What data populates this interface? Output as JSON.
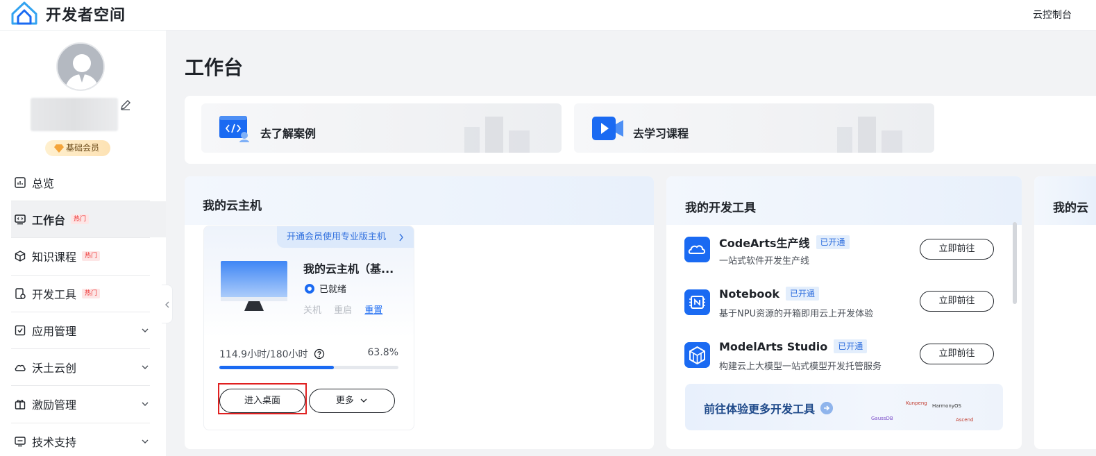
{
  "app": {
    "title": "开发者空间",
    "console_link": "云控制台"
  },
  "user": {
    "member_level": "基础会员"
  },
  "sidebar": {
    "items": [
      {
        "label": "总览",
        "icon": "overview-icon",
        "hot": false,
        "expandable": false,
        "active": false
      },
      {
        "label": "工作台",
        "icon": "workbench-icon",
        "hot": true,
        "expandable": false,
        "active": true
      },
      {
        "label": "知识课程",
        "icon": "cube-icon",
        "hot": true,
        "expandable": false,
        "active": false
      },
      {
        "label": "开发工具",
        "icon": "dev-tools-icon",
        "hot": true,
        "expandable": false,
        "active": false
      },
      {
        "label": "应用管理",
        "icon": "app-manage-icon",
        "hot": false,
        "expandable": true,
        "active": false
      },
      {
        "label": "沃土云创",
        "icon": "cloud-create-icon",
        "hot": false,
        "expandable": true,
        "active": false
      },
      {
        "label": "激励管理",
        "icon": "gift-icon",
        "hot": false,
        "expandable": true,
        "active": false
      },
      {
        "label": "技术支持",
        "icon": "support-icon",
        "hot": false,
        "expandable": true,
        "active": false
      }
    ],
    "hot_label": "热门"
  },
  "main": {
    "title": "工作台",
    "quick_links": [
      {
        "label": "去了解案例",
        "icon": "code-case-icon"
      },
      {
        "label": "去学习课程",
        "icon": "video-course-icon"
      }
    ],
    "cloud_host": {
      "section_title": "我的云主机",
      "vip_banner": "开通会员使用专业版主机",
      "name": "我的云主机（基...",
      "status": "已就绪",
      "actions": {
        "shutdown": "关机",
        "restart": "重启",
        "reset": "重置"
      },
      "usage_text": "114.9小时/180小时",
      "usage_percent_text": "63.8%",
      "usage_fraction": 0.638,
      "enter_button": "进入桌面",
      "more_button": "更多"
    },
    "dev_tools": {
      "section_title": "我的开发工具",
      "tools": [
        {
          "name": "CodeArts生产线",
          "tag": "已开通",
          "desc": "一站式软件开发生产线",
          "button": "立即前往",
          "icon": "codearts-icon"
        },
        {
          "name": "Notebook",
          "tag": "已开通",
          "desc": "基于NPU资源的开箱即用云上开发体验",
          "button": "立即前往",
          "icon": "notebook-icon"
        },
        {
          "name": "ModelArts Studio",
          "tag": "已开通",
          "desc": "构建云上大模型一站式模型开发托管服务",
          "button": "立即前往",
          "icon": "modelarts-icon"
        }
      ],
      "more_tools": "前往体验更多开发工具",
      "brands": [
        "Kunpeng",
        "HarmonyOS",
        "GaussDB",
        "Ascend"
      ]
    },
    "third_panel_title": "我的云"
  },
  "colors": {
    "accent": "#1a6af2",
    "highlight": "#e02020",
    "hot": "#e33333"
  }
}
